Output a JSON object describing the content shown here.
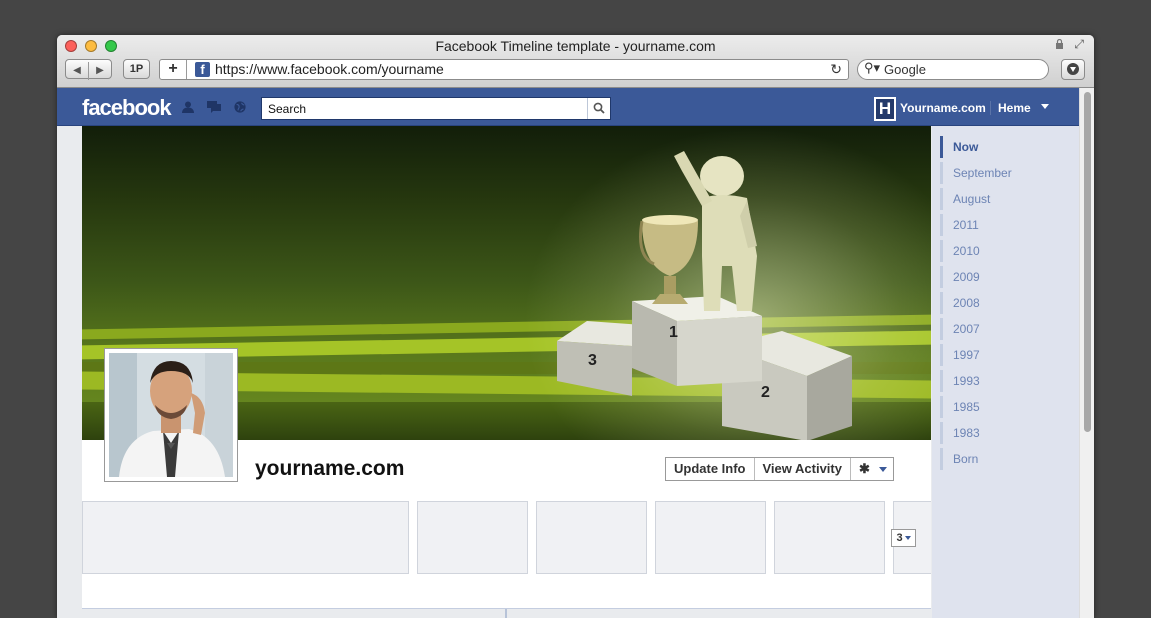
{
  "window": {
    "title": "Facebook Timeline template - yourname.com",
    "url": "https://www.facebook.com/yourname",
    "search_placeholder": "Google",
    "onepassword_label": "1P"
  },
  "facebook": {
    "logo": "facebook",
    "search_placeholder": "Search",
    "profile_initial": "H",
    "profile_name": "Yourname.com",
    "home_label": "Heme",
    "brand_color": "#3b5998"
  },
  "cover": {
    "podium_labels": [
      "1",
      "2",
      "3"
    ]
  },
  "profile": {
    "name": "yourname.com",
    "update_info": "Update Info",
    "view_activity": "View Activity",
    "more_count": "3"
  },
  "timeline": {
    "items": [
      "Now",
      "September",
      "August",
      "2011",
      "2010",
      "2009",
      "2008",
      "2007",
      "1997",
      "1993",
      "1985",
      "1983",
      "Born"
    ]
  }
}
